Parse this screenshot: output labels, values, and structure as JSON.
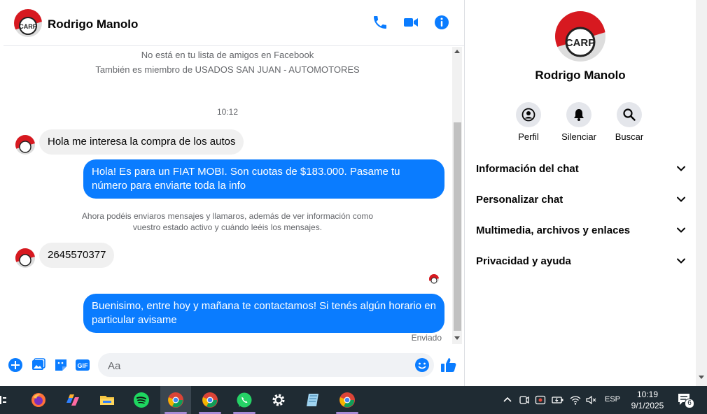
{
  "chat": {
    "contact_name": "Rodrigo Manolo",
    "notice_line1": "No está en tu lista de amigos en Facebook",
    "notice_line2": "También es miembro de USADOS SAN JUAN - AUTOMOTORES",
    "timestamp": "10:12",
    "messages": [
      {
        "dir": "in",
        "text": "Hola me interesa la compra de los autos"
      },
      {
        "dir": "out",
        "text": "Hola! Es para un FIAT MOBI. Son cuotas de $183.000. Pasame tu número para enviarte toda la info"
      },
      {
        "dir": "in",
        "text": "2645570377"
      },
      {
        "dir": "out",
        "text": "Buenisimo, entre hoy y mañana te contactamos! Si tenés algún horario en particular avisame"
      }
    ],
    "system_message": "Ahora podéis enviaros mensajes y llamaros, además de ver información como vuestro estado activo y cuándo leéis los mensajes.",
    "sent_status": "Enviado",
    "input_placeholder": "Aa",
    "accent_color": "#0a7cff"
  },
  "info": {
    "name": "Rodrigo Manolo",
    "actions": [
      {
        "label": "Perfil",
        "icon": "profile-icon"
      },
      {
        "label": "Silenciar",
        "icon": "bell-icon"
      },
      {
        "label": "Buscar",
        "icon": "search-icon"
      }
    ],
    "sections": [
      {
        "label": "Información del chat"
      },
      {
        "label": "Personalizar chat"
      },
      {
        "label": "Multimedia, archivos y enlaces"
      },
      {
        "label": "Privacidad y ayuda"
      }
    ]
  },
  "taskbar": {
    "language": "ESP",
    "time": "10:19",
    "date": "9/1/2025",
    "notification_count": "6",
    "apps": [
      "firefox-icon",
      "copilot-icon",
      "file-explorer-icon",
      "spotify-icon",
      "chrome-icon",
      "chrome-icon",
      "whatsapp-icon",
      "settings-icon",
      "notepad-icon",
      "chrome-icon"
    ]
  }
}
